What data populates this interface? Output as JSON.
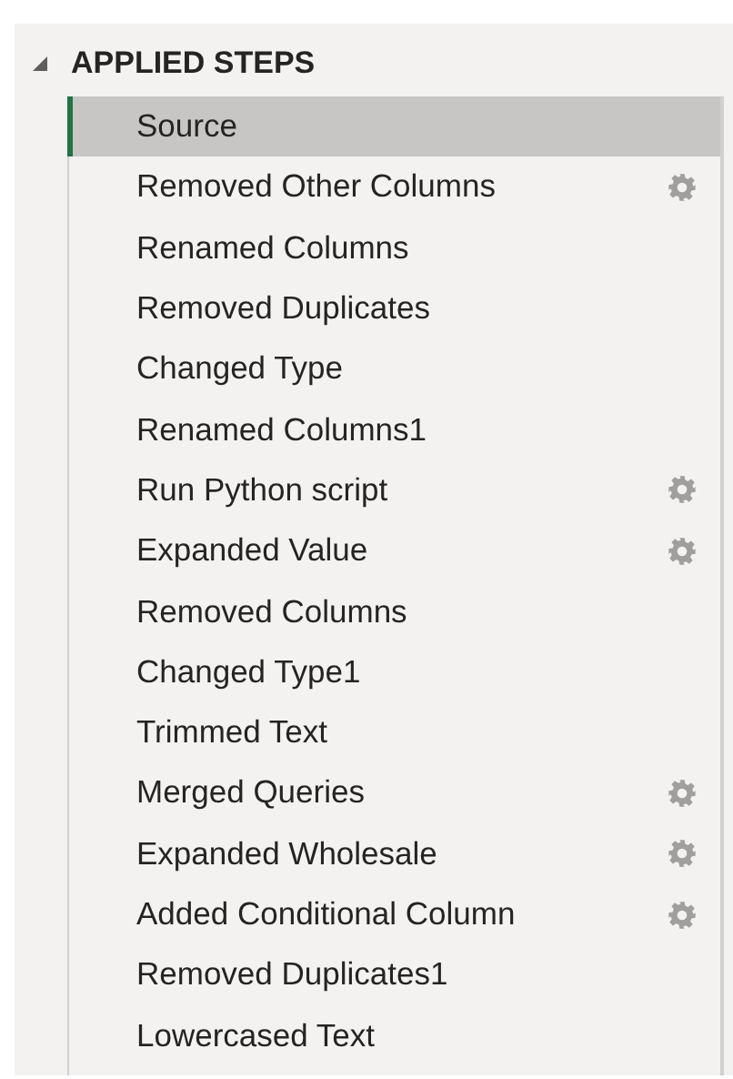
{
  "panel": {
    "title": "APPLIED STEPS",
    "expanded": true
  },
  "steps": [
    {
      "label": "Source",
      "selected": true,
      "has_settings": false
    },
    {
      "label": "Removed Other Columns",
      "selected": false,
      "has_settings": true
    },
    {
      "label": "Renamed Columns",
      "selected": false,
      "has_settings": false
    },
    {
      "label": "Removed Duplicates",
      "selected": false,
      "has_settings": false
    },
    {
      "label": "Changed Type",
      "selected": false,
      "has_settings": false
    },
    {
      "label": "Renamed Columns1",
      "selected": false,
      "has_settings": false
    },
    {
      "label": "Run Python script",
      "selected": false,
      "has_settings": true
    },
    {
      "label": "Expanded Value",
      "selected": false,
      "has_settings": true
    },
    {
      "label": "Removed Columns",
      "selected": false,
      "has_settings": false
    },
    {
      "label": "Changed Type1",
      "selected": false,
      "has_settings": false
    },
    {
      "label": "Trimmed Text",
      "selected": false,
      "has_settings": false
    },
    {
      "label": "Merged Queries",
      "selected": false,
      "has_settings": true
    },
    {
      "label": "Expanded Wholesale",
      "selected": false,
      "has_settings": true
    },
    {
      "label": "Added Conditional Column",
      "selected": false,
      "has_settings": true
    },
    {
      "label": "Removed Duplicates1",
      "selected": false,
      "has_settings": false
    },
    {
      "label": "Lowercased Text",
      "selected": false,
      "has_settings": false
    }
  ]
}
